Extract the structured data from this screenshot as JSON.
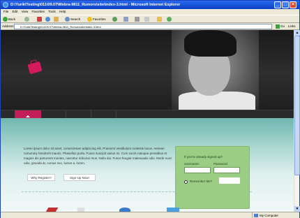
{
  "window": {
    "title": "D:\\Yurik\\Testing\\011\\09.07\\Webra-9811_Rumors\\site\\index-3.html - Microsoft Internet Explorer"
  },
  "menu": [
    "File",
    "Edit",
    "View",
    "Favorites",
    "Tools",
    "Help"
  ],
  "toolbar": {
    "back": "Back",
    "search": "Search",
    "favorites": "Favorites"
  },
  "address": {
    "label": "Address",
    "value": "D:\\Yurik\\Testing\\011\\09.07\\Webra-9811_Rumors\\site\\index-3.html",
    "go": "Go",
    "links": "Links"
  },
  "page": {
    "intro": "Lorem ipsum dolor sit amet, consectetuer adipiscing elit. Praesent vestibulum molestie lacus. Aenean nonummy hendrerit mauris. Phasellus porta. Fusce suscipit varius mi. Cum sociis natoque penatibus et magnis dis parturient montes, nascetur ridiculus mus. Nulla dui. Fusce feugiat malesuada odio. Morbi nunc odio, gravida at, cursus nec, luctus a, lorem.",
    "btn_register": "Why Register?",
    "btn_signup": "Sign-Up Now!",
    "login_title": "If you're already signed up?",
    "username_label": "Username:",
    "password_label": "Password",
    "remember_label": "Remember Me?"
  },
  "status": {
    "zone": "My Computer"
  },
  "colors": {
    "accent": "#c41e5a",
    "login_bg": "#9ccd84"
  }
}
